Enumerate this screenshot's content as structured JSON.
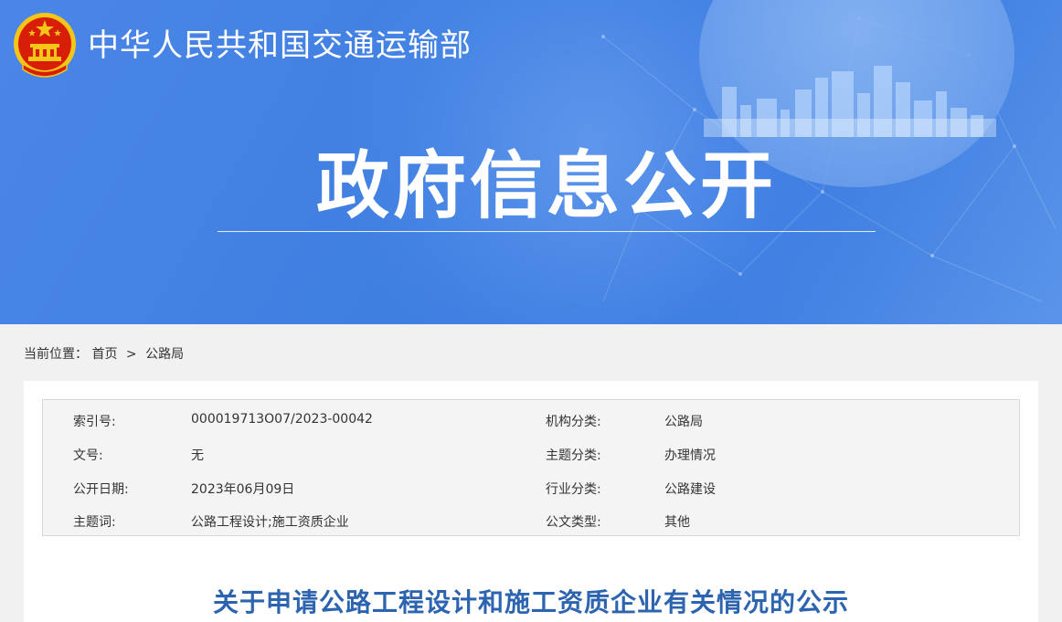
{
  "header": {
    "site_name": "中华人民共和国交通运输部",
    "banner_title": "政府信息公开"
  },
  "breadcrumb": {
    "label": "当前位置：",
    "home": "首页",
    "separator": ">",
    "current": "公路局"
  },
  "meta": {
    "rows": [
      {
        "k1": "索引号:",
        "v1": "000019713O07/2023-00042",
        "k2": "机构分类:",
        "v2": "公路局"
      },
      {
        "k1": "文号:",
        "v1": "无",
        "k2": "主题分类:",
        "v2": "办理情况"
      },
      {
        "k1": "公开日期:",
        "v1": "2023年06月09日",
        "k2": "行业分类:",
        "v2": "公路建设"
      },
      {
        "k1": "主题词:",
        "v1": "公路工程设计;施工资质企业",
        "k2": "公文类型:",
        "v2": "其他"
      }
    ]
  },
  "document": {
    "title": "关于申请公路工程设计和施工资质企业有关情况的公示"
  },
  "colors": {
    "banner_blue": "#3f7fe0",
    "title_blue": "#2c64b0",
    "emblem_red": "#d81e06",
    "emblem_gold": "#f5c518"
  },
  "icons": {
    "emblem": "national-emblem-icon"
  }
}
